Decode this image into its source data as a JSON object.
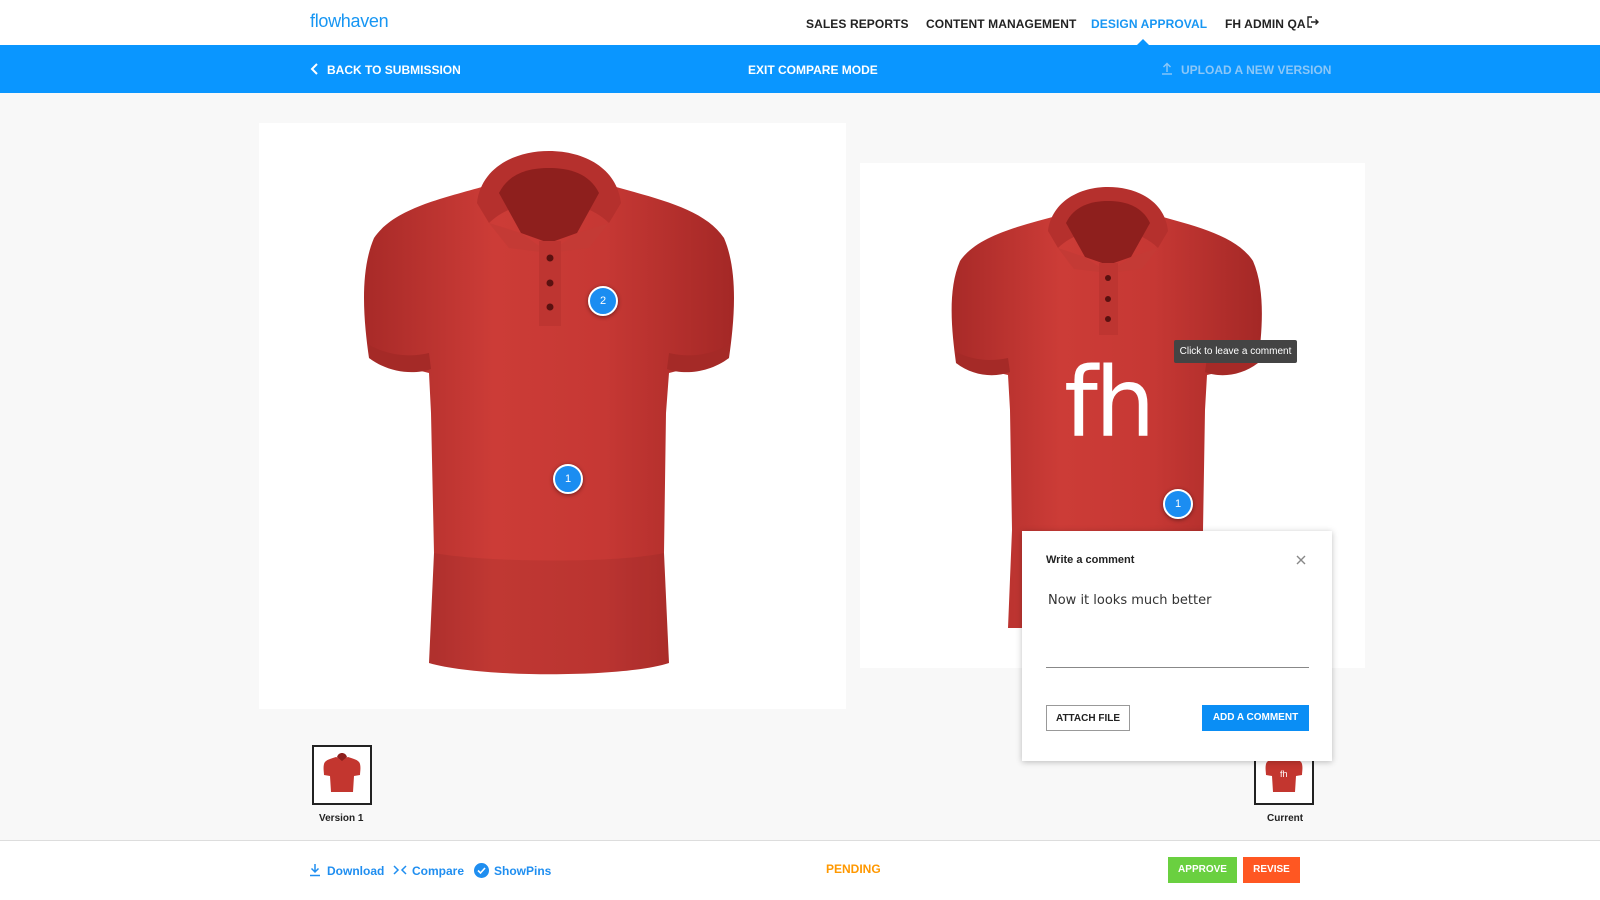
{
  "app": {
    "logo": "flowhaven"
  },
  "nav": {
    "items": [
      "SALES REPORTS",
      "CONTENT MANAGEMENT",
      "DESIGN APPROVAL",
      "FH ADMIN QA"
    ],
    "active_index": 2,
    "logout_icon": "logout-icon"
  },
  "subbar": {
    "back": "BACK TO SUBMISSION",
    "exit_compare": "EXIT COMPARE MODE",
    "upload": "UPLOAD A NEW VERSION"
  },
  "left_image": {
    "pins": [
      "2",
      "1"
    ]
  },
  "right_image": {
    "logo_text": "fh",
    "pins": [
      "1"
    ],
    "tooltip": "Click to leave a comment"
  },
  "thumbnails": {
    "left_label": "Version 1",
    "right_label": "Current"
  },
  "comment": {
    "title": "Write a comment",
    "text": "Now it looks much better",
    "attach": "ATTACH FILE",
    "submit": "ADD A COMMENT"
  },
  "footer": {
    "download": "Download",
    "compare": "Compare",
    "show_pins": "ShowPins",
    "status": "PENDING",
    "approve": "APPROVE",
    "revise": "REVISE"
  },
  "colors": {
    "accent": "#0a96ff",
    "shirt": "#c93a36",
    "approve": "#6ad040",
    "revise": "#ff5722",
    "pending": "#ff9800"
  }
}
